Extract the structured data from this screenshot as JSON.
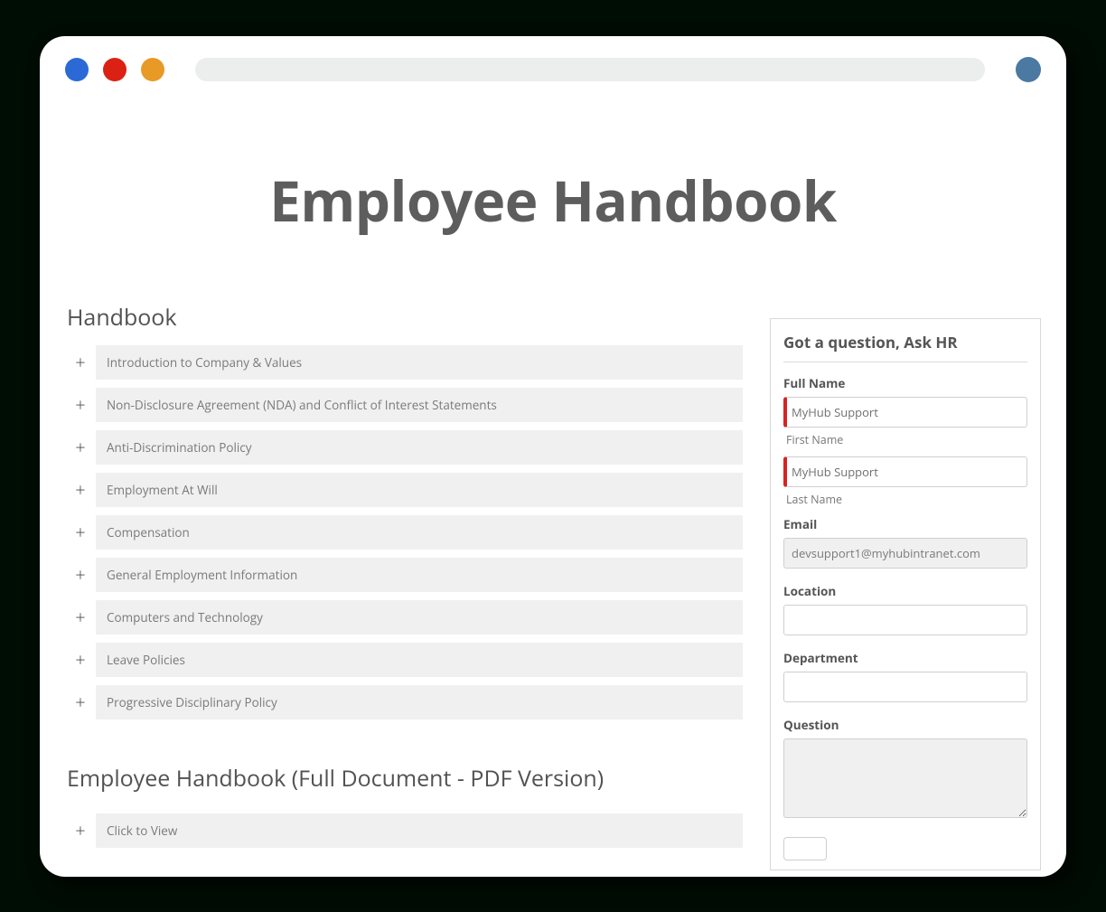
{
  "page": {
    "title": "Employee Handbook"
  },
  "handbook": {
    "heading": "Handbook",
    "items": [
      {
        "label": "Introduction to Company & Values"
      },
      {
        "label": "Non-Disclosure Agreement (NDA) and Conflict of Interest Statements"
      },
      {
        "label": "Anti-Discrimination Policy"
      },
      {
        "label": "Employment At Will"
      },
      {
        "label": "Compensation"
      },
      {
        "label": "General Employment Information"
      },
      {
        "label": "Computers and Technology"
      },
      {
        "label": "Leave Policies"
      },
      {
        "label": "Progressive Disciplinary Policy"
      }
    ]
  },
  "pdfSection": {
    "heading": "Employee Handbook (Full Document - PDF Version)",
    "items": [
      {
        "label": "Click to View"
      }
    ]
  },
  "hrForm": {
    "title": "Got a question, Ask HR",
    "fullNameLabel": "Full Name",
    "firstNameSub": "First Name",
    "lastNameSub": "Last Name",
    "firstNameValue": "MyHub Support",
    "lastNameValue": "MyHub Support",
    "emailLabel": "Email",
    "emailValue": "devsupport1@myhubintranet.com",
    "locationLabel": "Location",
    "locationValue": "",
    "departmentLabel": "Department",
    "departmentValue": "",
    "questionLabel": "Question",
    "questionValue": ""
  },
  "colors": {
    "dotBlue": "#2b6ad6",
    "dotRed": "#db2113",
    "dotOrange": "#e89a26",
    "avatar": "#4b79a1",
    "requiredBar": "#d62323"
  }
}
